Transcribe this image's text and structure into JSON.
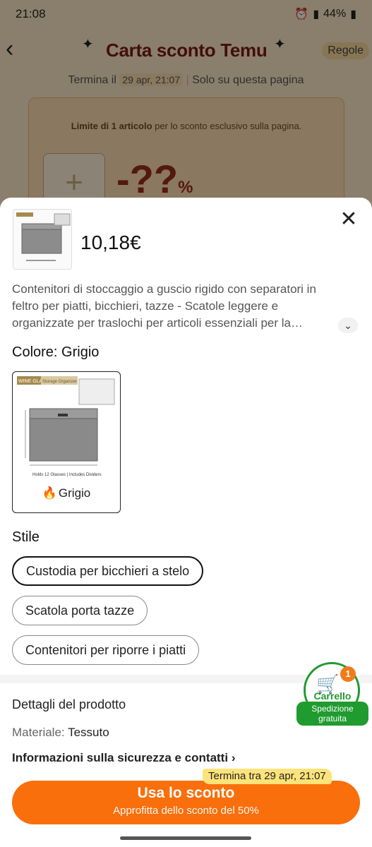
{
  "status_bar": {
    "time": "21:08",
    "battery": "44%"
  },
  "background": {
    "title": "Carta sconto Temu",
    "rules": "Regole",
    "ends_label": "Termina il",
    "ends_date": "29 apr, 21:07",
    "scope": "Solo su questa pagina",
    "limit_bold": "Limite di 1 articolo",
    "limit_rest": "per lo sconto esclusivo sulla pagina.",
    "discount": "-??",
    "discount_pct": "%"
  },
  "sheet": {
    "price": "10,18€",
    "description": "Contenitori di stoccaggio a guscio rigido con separatori in feltro per piatti, bicchieri, tazze - Scatole leggere e organizzate per traslochi per articoli essenziali per la…",
    "color_label": "Colore: Grigio",
    "color_option": "Grigio",
    "thumb_badge": "WINE GLASS",
    "thumb_sub": "Storage Organizer",
    "thumb_holds": "Holds 12 Glasses | Includes Dividers",
    "style_label": "Stile",
    "styles": [
      "Custodia per bicchieri a stelo",
      "Scatola porta tazze",
      "Contenitori per riporre i piatti"
    ],
    "details_title": "Dettagli del prodotto",
    "material_label": "Materiale:",
    "material_value": "Tessuto",
    "safety": "Informazioni sulla sicurezza e contatti"
  },
  "cart": {
    "label": "Carrello",
    "count": "1",
    "shipping": "Spedizione gratuita"
  },
  "cta": {
    "timer": "Termina tra 29 apr, 21:07",
    "main": "Usa lo sconto",
    "sub": "Approfitta dello sconto del 50%"
  }
}
